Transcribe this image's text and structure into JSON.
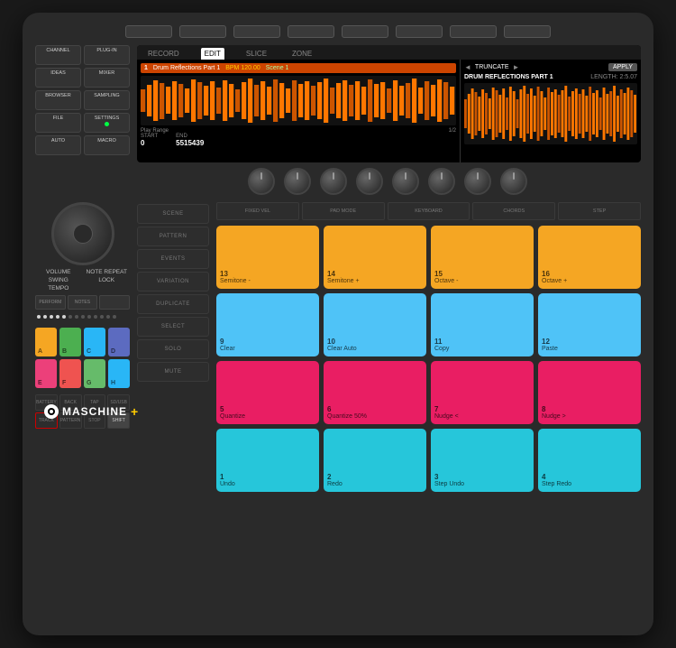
{
  "device": {
    "brand": "MASCHINE",
    "model": "+"
  },
  "screen": {
    "tabs": [
      "RECORD",
      "EDIT",
      "SLICE",
      "ZONE"
    ],
    "active_tab": "EDIT",
    "track": {
      "number": "1",
      "name": "Drum Reflections Part 1",
      "bpm": "BPM 120.00",
      "scene": "Scene 1"
    },
    "play_range": {
      "label": "Play Range",
      "start_label": "START",
      "end_label": "END",
      "start": "0",
      "end": "5515439",
      "page": "1/2"
    },
    "right_panel": {
      "truncate": "TRUNCATE",
      "apply": "APPLY",
      "track_name": "DRUM REFLECTIONS PART 1",
      "length_label": "LENGTH:",
      "length": "2:5.07"
    }
  },
  "knobs": [
    "K1",
    "K2",
    "K3",
    "K4",
    "K5",
    "K6",
    "K7",
    "K8"
  ],
  "left_controls": {
    "small_buttons": [
      {
        "main": "CHANNEL",
        "sub": ""
      },
      {
        "main": "PLUG-IN",
        "sub": ""
      },
      {
        "main": "IDEAS",
        "sub": ""
      },
      {
        "main": "MIXER",
        "sub": ""
      },
      {
        "main": "BROWSER",
        "sub": ""
      },
      {
        "main": "SAMPLING",
        "sub": ""
      },
      {
        "main": "FILE",
        "sub": ""
      },
      {
        "main": "SETTINGS",
        "sub": ""
      },
      {
        "main": "AUTO",
        "sub": ""
      },
      {
        "main": "MACRO",
        "sub": ""
      }
    ],
    "volume_label": "VOLUME",
    "note_repeat_label": "NOTE REPEAT",
    "swing_label": "SWING",
    "tempo_label": "TEMPO",
    "lock_label": "LOCK"
  },
  "side_buttons": [
    "SCENE",
    "PATTERN",
    "EVENTS",
    "VARIATION",
    "DUPLICATE",
    "SELECT",
    "SOLO",
    "MUTE"
  ],
  "pad_mode_buttons": [
    "FIXED VEL",
    "PAD MODE",
    "KEYBOARD",
    "CHORDS",
    "STEP"
  ],
  "big_pads": [
    {
      "num": "13",
      "label": "Semitone -",
      "color": "#f5a623"
    },
    {
      "num": "14",
      "label": "Semitone +",
      "color": "#f5a623"
    },
    {
      "num": "15",
      "label": "Octave -",
      "color": "#f5a623"
    },
    {
      "num": "16",
      "label": "Octave +",
      "color": "#f5a623"
    },
    {
      "num": "9",
      "label": "Clear",
      "color": "#4fc3f7"
    },
    {
      "num": "10",
      "label": "Clear Auto",
      "color": "#4fc3f7"
    },
    {
      "num": "11",
      "label": "Copy",
      "color": "#4fc3f7"
    },
    {
      "num": "12",
      "label": "Paste",
      "color": "#4fc3f7"
    },
    {
      "num": "5",
      "label": "Quantize",
      "color": "#e91e63"
    },
    {
      "num": "6",
      "label": "Quantize 50%",
      "color": "#e91e63"
    },
    {
      "num": "7",
      "label": "Nudge <",
      "color": "#e91e63"
    },
    {
      "num": "8",
      "label": "Nudge >",
      "color": "#e91e63"
    },
    {
      "num": "1",
      "label": "Undo",
      "color": "#26c6da"
    },
    {
      "num": "2",
      "label": "Redo",
      "color": "#26c6da"
    },
    {
      "num": "3",
      "label": "Step Undo",
      "color": "#26c6da"
    },
    {
      "num": "4",
      "label": "Step Redo",
      "color": "#26c6da"
    }
  ],
  "mini_pads": [
    {
      "label": "A",
      "color": "#f5a623"
    },
    {
      "label": "B",
      "color": "#4caf50"
    },
    {
      "label": "C",
      "color": "#29b6f6"
    },
    {
      "label": "D",
      "color": "#5c6bc0"
    },
    {
      "label": "E",
      "color": "#ec407a"
    },
    {
      "label": "F",
      "color": "#ef5350"
    },
    {
      "label": "G",
      "color": "#66bb6a"
    },
    {
      "label": "H",
      "color": "#29b6f6"
    }
  ],
  "bottom_buttons": [
    "BATTERY",
    "BACK",
    "TAP",
    "SD/USB",
    "TRACK",
    "PATTERN",
    "STOP",
    "SHIFT"
  ],
  "perform_buttons": [
    "PERFORM",
    "NOTES",
    ""
  ],
  "top_buttons_count": 8
}
